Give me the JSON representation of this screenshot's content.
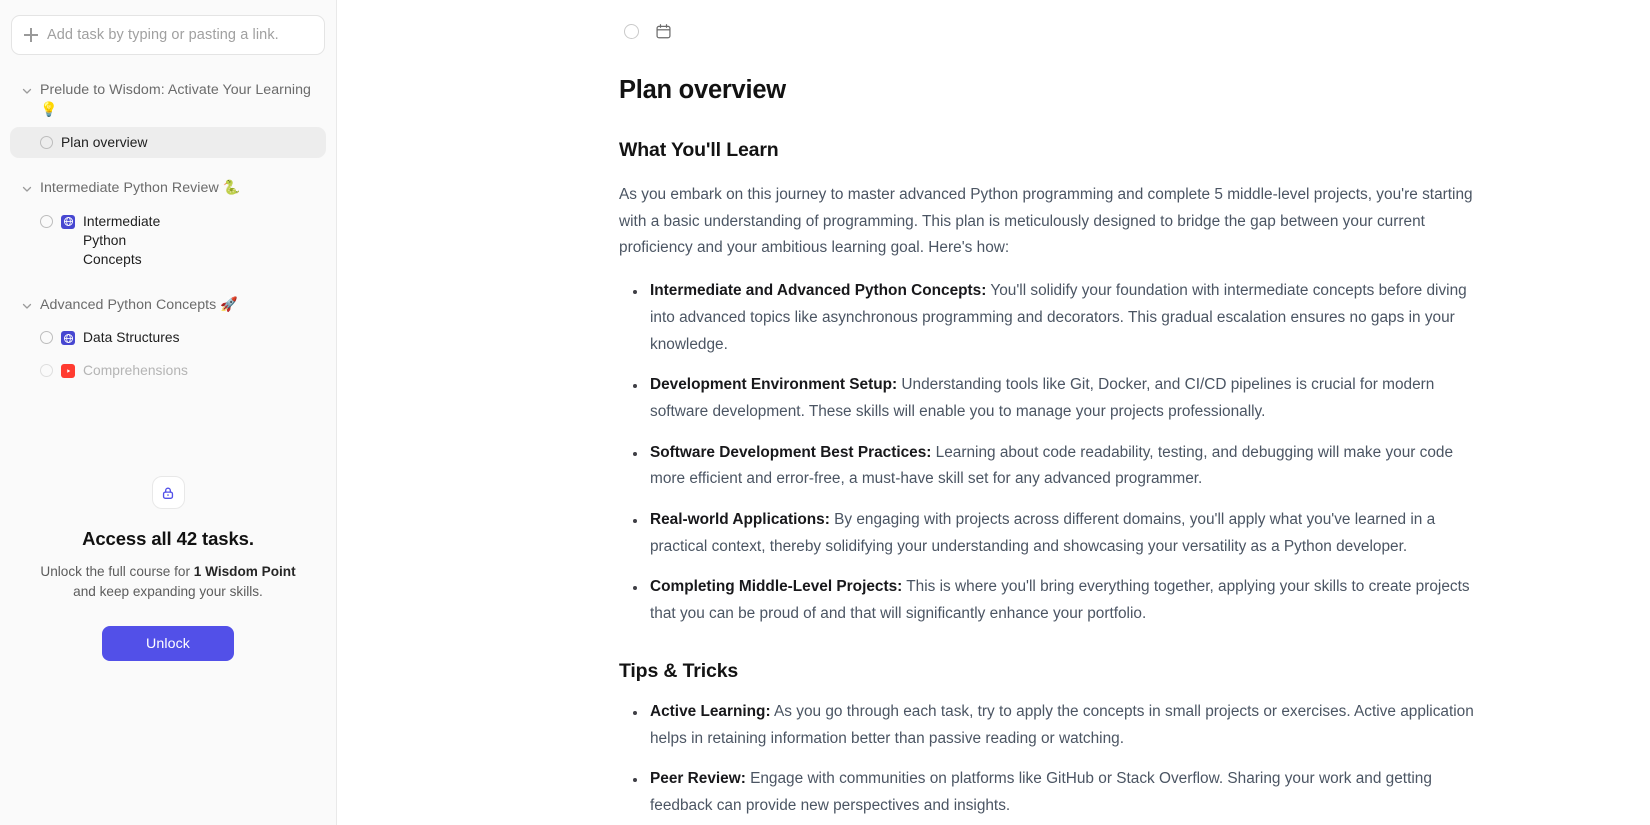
{
  "sidebar": {
    "add_task": {
      "placeholder": "Add task by typing or pasting a link.",
      "icon": "plus-icon"
    },
    "groups": [
      {
        "title": "Prelude to Wisdom: Activate Your Learning 💡",
        "expanded": true,
        "tasks": [
          {
            "label": "Plan overview",
            "active": true,
            "icon": null,
            "locked": false
          }
        ]
      },
      {
        "title": "Intermediate Python Review 🐍",
        "expanded": true,
        "tasks": [
          {
            "label": "Intermediate Python Concepts",
            "active": false,
            "icon": "globe-icon",
            "locked": false
          }
        ]
      },
      {
        "title": "Advanced Python Concepts 🚀",
        "expanded": true,
        "tasks": [
          {
            "label": "Data Structures",
            "active": false,
            "icon": "globe-icon",
            "locked": false
          },
          {
            "label": "Comprehensions",
            "active": false,
            "icon": "youtube-icon",
            "locked": true
          }
        ]
      }
    ],
    "unlock": {
      "icon": "lock-icon",
      "title": "Access all 42 tasks.",
      "sub_before": "Unlock the full course for ",
      "sub_bold": "1 Wisdom Point",
      "sub_after": " and keep expanding your skills.",
      "button_label": "Unlock",
      "button_color": "#5250e8"
    }
  },
  "main": {
    "toolbar": {
      "checkbox": "task-complete-checkbox",
      "calendar": "calendar-icon"
    },
    "title": "Plan overview",
    "sections": [
      {
        "heading": "What You'll Learn",
        "paragraph": "As you embark on this journey to master advanced Python programming and complete 5 middle-level projects, you're starting with a basic understanding of programming. This plan is meticulously designed to bridge the gap between your current proficiency and your ambitious learning goal. Here's how:",
        "bullets": [
          {
            "term": "Intermediate and Advanced Python Concepts:",
            "text": " You'll solidify your foundation with intermediate concepts before diving into advanced topics like asynchronous programming and decorators. This gradual escalation ensures no gaps in your knowledge."
          },
          {
            "term": "Development Environment Setup:",
            "text": " Understanding tools like Git, Docker, and CI/CD pipelines is crucial for modern software development. These skills will enable you to manage your projects professionally."
          },
          {
            "term": "Software Development Best Practices:",
            "text": " Learning about code readability, testing, and debugging will make your code more efficient and error-free, a must-have skill set for any advanced programmer."
          },
          {
            "term": "Real-world Applications:",
            "text": " By engaging with projects across different domains, you'll apply what you've learned in a practical context, thereby solidifying your understanding and showcasing your versatility as a Python developer."
          },
          {
            "term": "Completing Middle-Level Projects:",
            "text": " This is where you'll bring everything together, applying your skills to create projects that you can be proud of and that will significantly enhance your portfolio."
          }
        ]
      },
      {
        "heading": "Tips & Tricks",
        "paragraph": null,
        "bullets": [
          {
            "term": "Active Learning:",
            "text": " As you go through each task, try to apply the concepts in small projects or exercises. Active application helps in retaining information better than passive reading or watching."
          },
          {
            "term": "Peer Review:",
            "text": " Engage with communities on platforms like GitHub or Stack Overflow. Sharing your work and getting feedback can provide new perspectives and insights."
          }
        ]
      }
    ]
  }
}
